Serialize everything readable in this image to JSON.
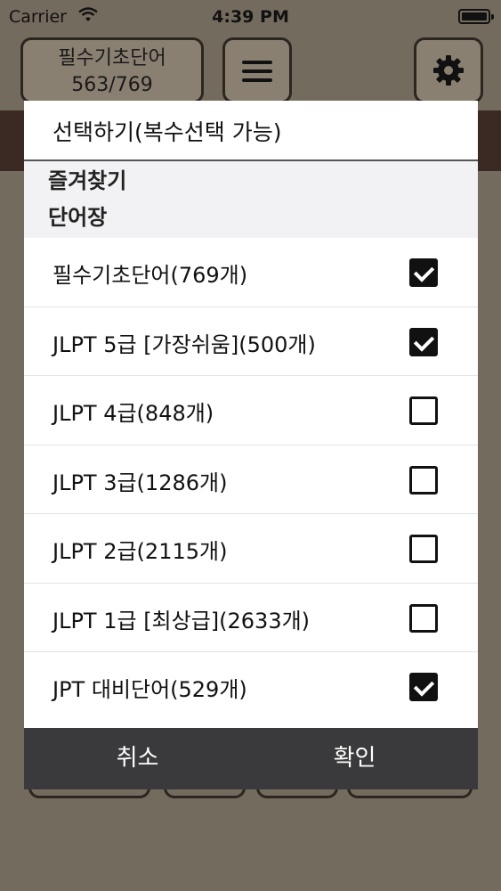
{
  "status_bar": {
    "carrier": "Carrier",
    "time": "4:39 PM"
  },
  "toolbar": {
    "deck_name": "필수기초단어",
    "deck_progress": "563/769"
  },
  "dialog": {
    "title": "선택하기(복수선택 가능)",
    "sections": {
      "favorites": "즐겨찾기",
      "wordbook": "단어장"
    },
    "options": [
      {
        "label": "필수기초단어(769개)",
        "checked": true
      },
      {
        "label": "JLPT 5급 [가장쉬움](500개)",
        "checked": true
      },
      {
        "label": "JLPT 4급(848개)",
        "checked": false
      },
      {
        "label": "JLPT 3급(1286개)",
        "checked": false
      },
      {
        "label": "JLPT 2급(2115개)",
        "checked": false
      },
      {
        "label": "JLPT 1급 [최상급](2633개)",
        "checked": false
      },
      {
        "label": "JPT 대비단어(529개)",
        "checked": true
      }
    ],
    "cancel_label": "취소",
    "confirm_label": "확인"
  }
}
